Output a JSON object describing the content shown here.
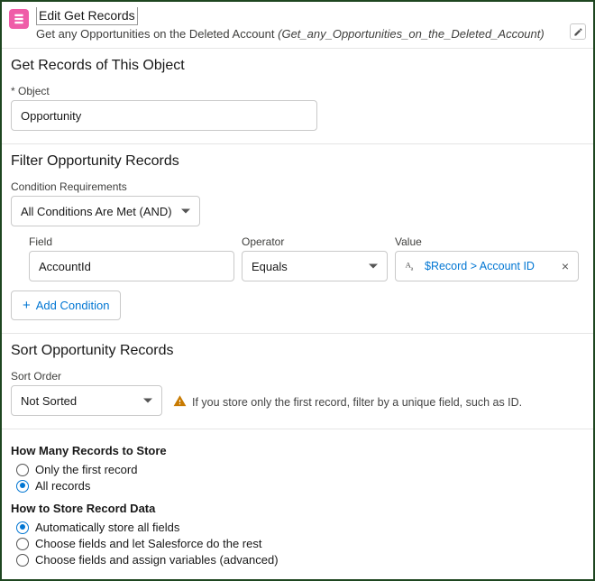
{
  "header": {
    "title": "Edit Get Records",
    "subtitle_prefix": "Get any Opportunities on the Deleted Account ",
    "api_name": "(Get_any_Opportunities_on_the_Deleted_Account)"
  },
  "object": {
    "section_title": "Get Records of This Object",
    "label": "Object",
    "value": "Opportunity"
  },
  "filter": {
    "section_title": "Filter Opportunity Records",
    "cond_req_label": "Condition Requirements",
    "cond_req_value": "All Conditions Are Met (AND)",
    "cols": {
      "field": "Field",
      "operator": "Operator",
      "value": "Value"
    },
    "row": {
      "field": "AccountId",
      "operator": "Equals",
      "value_text": "$Record > Account ID"
    },
    "add_label": "Add Condition"
  },
  "sort": {
    "section_title": "Sort Opportunity Records",
    "order_label": "Sort Order",
    "order_value": "Not Sorted",
    "warning": "If you store only the first record, filter by a unique field, such as ID."
  },
  "store": {
    "how_many_heading": "How Many Records to Store",
    "how_many": [
      {
        "label": "Only the first record",
        "checked": false
      },
      {
        "label": "All records",
        "checked": true
      }
    ],
    "how_store_heading": "How to Store Record Data",
    "how_store": [
      {
        "label": "Automatically store all fields",
        "checked": true
      },
      {
        "label": "Choose fields and let Salesforce do the rest",
        "checked": false
      },
      {
        "label": "Choose fields and assign variables (advanced)",
        "checked": false
      }
    ]
  }
}
